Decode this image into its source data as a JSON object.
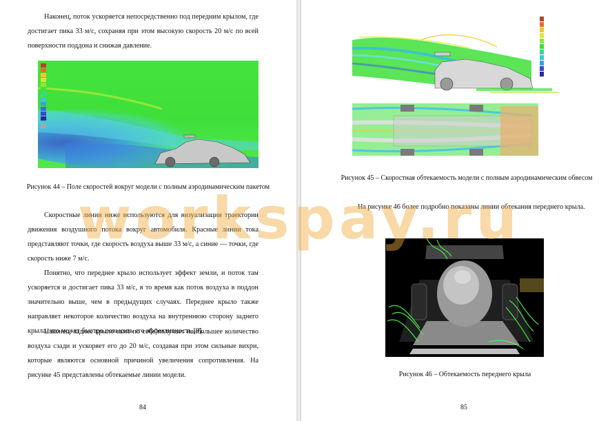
{
  "left_page": {
    "para1": "Наконец, поток ускоряется непосредственно под передним крылом, где достигает пика 33 м/с, сохраняя при этом высокую скорость 20 м/с по всей поверхности поддона и снижая давление.",
    "figure44_caption": "Рисунок 44 – Поле скоростей вокруг модели с полным аэродинамическим пакетом",
    "para2": "Скоростные линии ниже используются для визуализации траектории движения воздушного потока вокруг автомобиля. Красные линии тока представляют точки, где скорость воздуха выше 33 м/с, а синие — точки, где скорость ниже 7 м/с.",
    "para3": "Понятно, что переднее крыло использует эффект земли, и поток там ускоряется и достигает пика 33 м/с, в то время как поток воздуха в поддон значительно выше, чем в предыдущих случаях. Переднее крыло также направляет некоторое количество воздуха на внутреннюю сторону заднего крыла, что может быстро повысить его эффективность [9].",
    "para4": "Наконец, заднее крыло само по себе получает наибольшее количество воздуха сзади и ускоряет его до 20 м/с, создавая при этом сильные вихри, которые являются основной причиной увеличения сопротивления. На рисунке 45 представлены обтекаемые линии модели.",
    "page_number": "84"
  },
  "right_page": {
    "figure45_caption": "Рисунок 45 – Скоростная обтекаемость модели с полным аэродинамическим обвесом",
    "para1": "На рисунке 46 более подробно показаны линии обтекания переднего крыла.",
    "figure46_caption": "Рисунок 46 – Обтекаемость переднего крыла",
    "page_number": "85"
  },
  "watermark": "workspay.ru",
  "colors": {
    "field_green": "#3ee03a",
    "field_cyan": "#3fc6e6",
    "field_blue": "#3a5bd8",
    "render_black": "#000000",
    "watermark": "#f0aa3c"
  }
}
